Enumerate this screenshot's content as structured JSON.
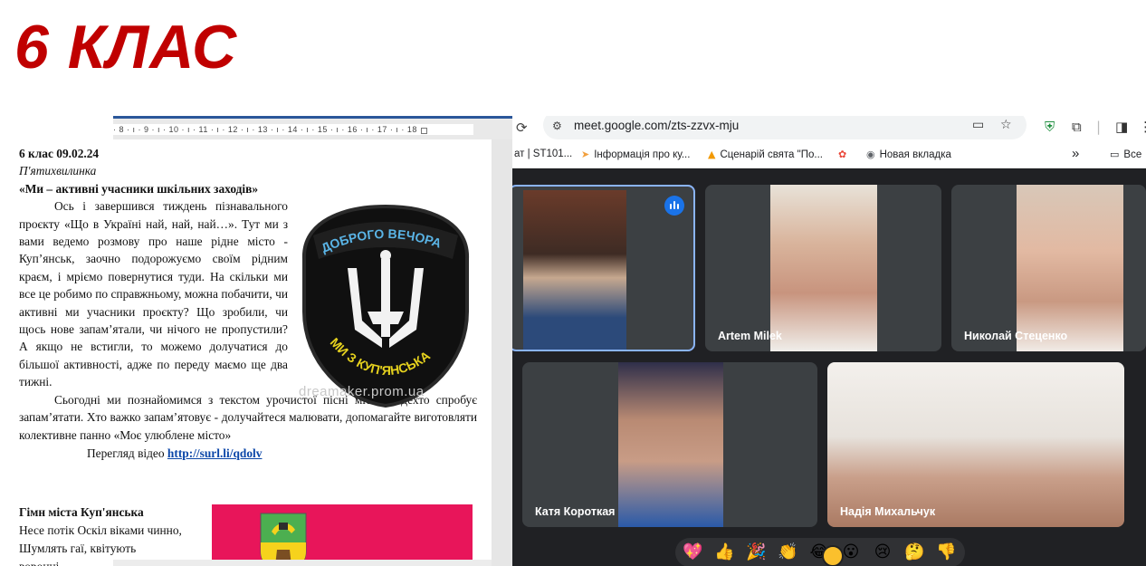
{
  "slide": {
    "title": "6 КЛАС"
  },
  "document": {
    "ruler": {
      "ticks": "· 8 · ı · 9 · ı · 10 · ı · 11 · ı · 12 · ı · 13 · ı · 14 · ı · 15 · ı · 16 · ı · 17 · ı · 18 ·"
    },
    "date_line": "6 клас 09.02.24",
    "subtitle": "П'ятихвилинка",
    "heading": "«Ми –  активні учасники шкільних заходів»",
    "paragraph1": "Ось і завершився тиждень пізнавального проєкту «Що в Україні най, най, най…». Тут ми з вами ведемо розмову про наше рідне місто - Куп’янськ, заочно подорожуємо своїм рідним краєм, і мріємо повернутися туди. На скільки ми все це робимо по справжньому, можна побачити, чи активні ми учасники проєкту? Що зробили, чи щось нове запам’ятали, чи нічого не пропустили? А якщо не встигли, то можемо долучатися до більшої активності, адже по переду маємо ще два тижні.",
    "paragraph2": "Сьогодні ми познайомимся з текстом урочистої пісні міста, і дехто спробує запам’ятати. Хто важко запам’ятовує - долучайтеся малювати, допомагайте виготовляти колективне панно «Моє улюблене місто»",
    "video_label": "Перегляд відео ",
    "video_link": "http://surl.li/qdolv",
    "hymn_title": "Гімн міста Куп'янська",
    "hymn_line1": "Несе потік Оскіл віками чинно,",
    "hymn_line2": "Шумлять гаї, квітують",
    "hymn_line3": "воронці...",
    "patch": {
      "top_text": "ДОБРОГО ВЕЧОРА",
      "bottom_text": "МИ З КУП'ЯНСЬКА"
    },
    "watermark": "dreamaker.prom.ua",
    "flag_color": "#e8155a"
  },
  "browser": {
    "url": "meet.google.com/zts-zzvx-mju",
    "bookmarks": [
      {
        "icon": "chat-icon",
        "label": "ат | ST101..."
      },
      {
        "icon": "pin-icon",
        "label": "Інформація про ку..."
      },
      {
        "icon": "bell-icon",
        "label": "Сценарій свята \"По..."
      },
      {
        "icon": "photos-icon",
        "label": ""
      },
      {
        "icon": "globe-icon",
        "label": "Новая вкладка"
      }
    ],
    "more_bookmarks": "»",
    "all_bookmarks": "Все"
  },
  "meet": {
    "participants": [
      {
        "name": ""
      },
      {
        "name": "Artem Milek"
      },
      {
        "name": "Николай Стеценко"
      },
      {
        "name": "Катя Короткая"
      },
      {
        "name": "Надія Михальчук"
      }
    ],
    "reactions": [
      "💖",
      "👍",
      "🎉",
      "👏",
      "😂",
      "😮",
      "😢",
      "🤔",
      "👎"
    ],
    "accent_color": "#8ab4f8"
  }
}
